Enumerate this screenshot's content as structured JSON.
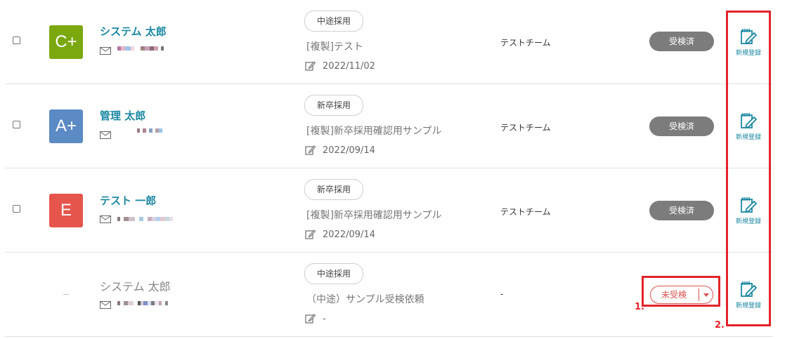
{
  "rows": [
    {
      "avatar_text": "C+",
      "avatar_color": "#7ba80f",
      "name": "システム 太郎",
      "hiring_type": "中途採用",
      "exam_title": "[複製]テスト",
      "date": "2022/11/02",
      "team": "テストチーム",
      "status": "受検済",
      "register_label": "新規登録"
    },
    {
      "avatar_text": "A+",
      "avatar_color": "#5b8ac5",
      "name": "管理 太郎",
      "hiring_type": "新卒採用",
      "exam_title": "[複製]新卒採用確認用サンプル",
      "date": "2022/09/14",
      "team": "テストチーム",
      "status": "受検済",
      "register_label": "新規登録"
    },
    {
      "avatar_text": "E",
      "avatar_color": "#e5554b",
      "name": "テスト 一郎",
      "hiring_type": "新卒採用",
      "exam_title": "[複製]新卒採用確認用サンプル",
      "date": "2022/09/14",
      "team": "テストチーム",
      "status": "受検済",
      "register_label": "新規登録"
    },
    {
      "avatar_text": "–",
      "avatar_color": "",
      "name": "システム 太郎",
      "hiring_type": "中途採用",
      "exam_title": "（中途）サンプル受検依頼",
      "date": "-",
      "team": "-",
      "status": "未受検",
      "register_label": "新規登録"
    }
  ],
  "annotations": {
    "label_1": "1.",
    "label_2": "2."
  },
  "colors": {
    "accent": "#1b88a3",
    "highlight": "#e3242b",
    "status_done": "#7c7c7c",
    "status_pending": "#d9534f"
  }
}
